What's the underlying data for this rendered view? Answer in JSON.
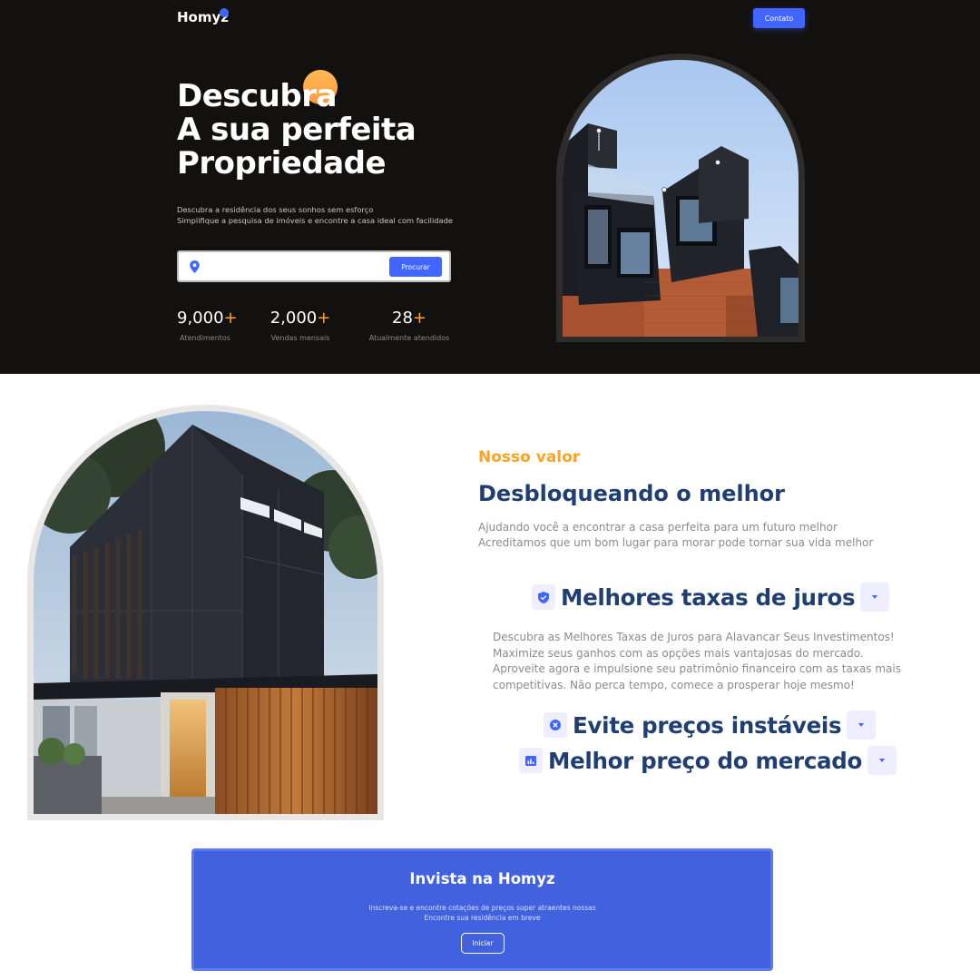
{
  "header": {
    "logo": "Homyz",
    "contact_label": "Contato"
  },
  "hero": {
    "title_lines": [
      "Descubra",
      "A sua perfeita",
      "Propriedade"
    ],
    "description_lines": [
      "Descubra a residência dos seus sonhos sem esforço",
      "Simplifique a pesquisa de imóveis e encontre a casa ideal com facilidade"
    ],
    "search": {
      "placeholder": "",
      "value": "",
      "button_label": "Procurar"
    },
    "stats": [
      {
        "value": "9,000",
        "plus": "+",
        "label": "Atendimentos"
      },
      {
        "value": "2,000",
        "plus": "+",
        "label": "Vendas mensais"
      },
      {
        "value": "28",
        "plus": "+",
        "label": "Atualmente atendidos"
      }
    ]
  },
  "value": {
    "kicker": "Nosso valor",
    "title": "Desbloqueando o melhor",
    "description_lines": [
      "Ajudando você a encontrar a casa perfeita para um futuro melhor",
      "Acreditamos que um bom lugar para morar pode tornar sua vida melhor"
    ],
    "accordion": [
      {
        "icon": "shield-check-icon",
        "title": "Melhores taxas de juros",
        "expanded": true,
        "body_lines": [
          "Descubra as Melhores Taxas de Juros para Alavancar Seus Investimentos!",
          "Maximize seus ganhos com as opções mais vantajosas do mercado.",
          "Aproveite agora e impulsione seu patrimônio financeiro com as taxas mais",
          "competitivas. Não perca tempo, comece a prosperar hoje mesmo!"
        ]
      },
      {
        "icon": "cancel-circle-icon",
        "title": "Evite preços instáveis",
        "expanded": false
      },
      {
        "icon": "analytics-chart-icon",
        "title": "Melhor preço do mercado",
        "expanded": false
      }
    ]
  },
  "cta": {
    "title": "Invista na Homyz",
    "description_lines": [
      "Inscreva-se e encontre cotações de preços super atraentes nossas",
      "Encontre sua residência em breve"
    ],
    "button_label": "Iniciar"
  },
  "colors": {
    "primary": "#4066ff",
    "accent_orange": "#ffa21f",
    "heading_navy": "#1f3e72",
    "hero_bg": "#131110",
    "cta_bg": "#4161df"
  }
}
